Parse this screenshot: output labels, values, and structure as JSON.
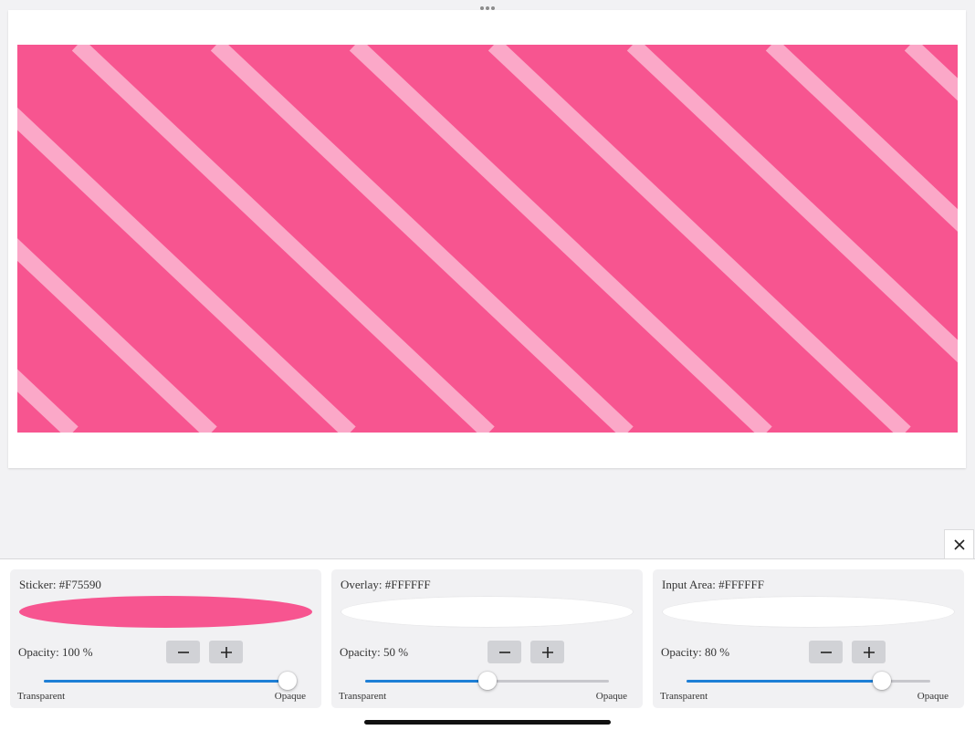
{
  "canvas": {
    "sticker_color": "#F75590",
    "stripe_color": "#FBA8C8"
  },
  "close_icon": "close-icon",
  "cards": [
    {
      "title": "Sticker: #F75590",
      "swatch_color": "#F75590",
      "opacity_label": "Opacity: 100 %",
      "opacity_value": 1.0,
      "min_label": "Transparent",
      "max_label": "Opaque"
    },
    {
      "title": "Overlay: #FFFFFF",
      "swatch_color": "#FFFFFF",
      "opacity_label": "Opacity: 50 %",
      "opacity_value": 0.5,
      "min_label": "Transparent",
      "max_label": "Opaque"
    },
    {
      "title": "Input Area: #FFFFFF",
      "swatch_color": "#FFFFFF",
      "opacity_label": "Opacity: 80 %",
      "opacity_value": 0.8,
      "min_label": "Transparent",
      "max_label": "Opaque"
    }
  ],
  "accent_color": "#1E7FD6"
}
